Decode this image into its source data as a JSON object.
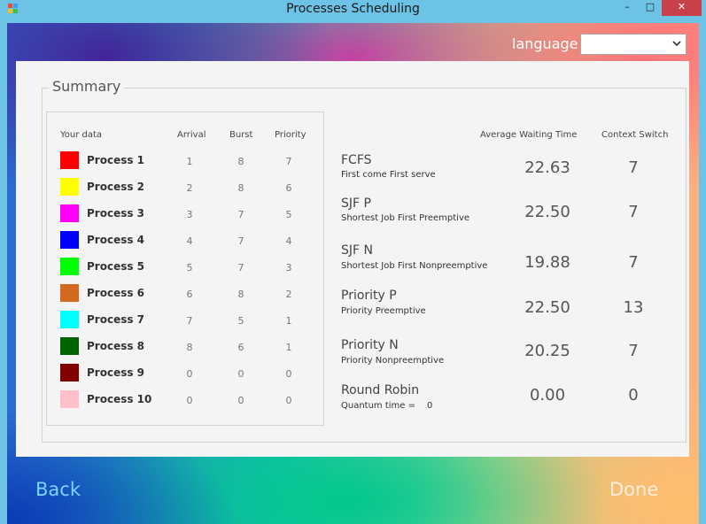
{
  "window": {
    "title": "Processes Scheduling"
  },
  "titlebar": {
    "minimize": "–",
    "maximize": "□",
    "close": "✕"
  },
  "language": {
    "label": "language",
    "selected": ""
  },
  "summary": {
    "title": "Summary",
    "headers": {
      "your_data": "Your data",
      "arrival": "Arrival",
      "burst": "Burst",
      "priority": "Priority"
    },
    "processes": [
      {
        "name": "Process 1",
        "color": "#ff0000",
        "arrival": "1",
        "burst": "8",
        "priority": "7"
      },
      {
        "name": "Process 2",
        "color": "#ffff00",
        "arrival": "2",
        "burst": "8",
        "priority": "6"
      },
      {
        "name": "Process 3",
        "color": "#ff00ff",
        "arrival": "3",
        "burst": "7",
        "priority": "5"
      },
      {
        "name": "Process 4",
        "color": "#0000ff",
        "arrival": "4",
        "burst": "7",
        "priority": "4"
      },
      {
        "name": "Process 5",
        "color": "#00ff00",
        "arrival": "5",
        "burst": "7",
        "priority": "3"
      },
      {
        "name": "Process 6",
        "color": "#d2691e",
        "arrival": "6",
        "burst": "8",
        "priority": "2"
      },
      {
        "name": "Process 7",
        "color": "#00ffff",
        "arrival": "7",
        "burst": "5",
        "priority": "1"
      },
      {
        "name": "Process 8",
        "color": "#006400",
        "arrival": "8",
        "burst": "6",
        "priority": "1"
      },
      {
        "name": "Process 9",
        "color": "#800000",
        "arrival": "0",
        "burst": "0",
        "priority": "0"
      },
      {
        "name": "Process 10",
        "color": "#ffc0cb",
        "arrival": "0",
        "burst": "0",
        "priority": "0"
      }
    ],
    "results_headers": {
      "avg_waiting": "Average Waiting Time",
      "context_switch": "Context Switch"
    },
    "algorithms": [
      {
        "name": "FCFS",
        "subtitle": "First come First serve",
        "avg": "22.63",
        "cs": "7"
      },
      {
        "name": "SJF P",
        "subtitle": "Shortest Job First Preemptive",
        "avg": "22.50",
        "cs": "7"
      },
      {
        "name": "SJF N",
        "subtitle": "Shortest Job First Nonpreemptive",
        "avg": "19.88",
        "cs": "7"
      },
      {
        "name": "Priority P",
        "subtitle": "Priority Preemptive",
        "avg": "22.50",
        "cs": "13"
      },
      {
        "name": "Priority N",
        "subtitle": "Priority Nonpreemptive",
        "avg": "20.25",
        "cs": "7"
      },
      {
        "name": "Round Robin",
        "subtitle": "Quantum time =",
        "quantum": "0",
        "avg": "0.00",
        "cs": "0"
      }
    ]
  },
  "nav": {
    "back": "Back",
    "done": "Done"
  }
}
